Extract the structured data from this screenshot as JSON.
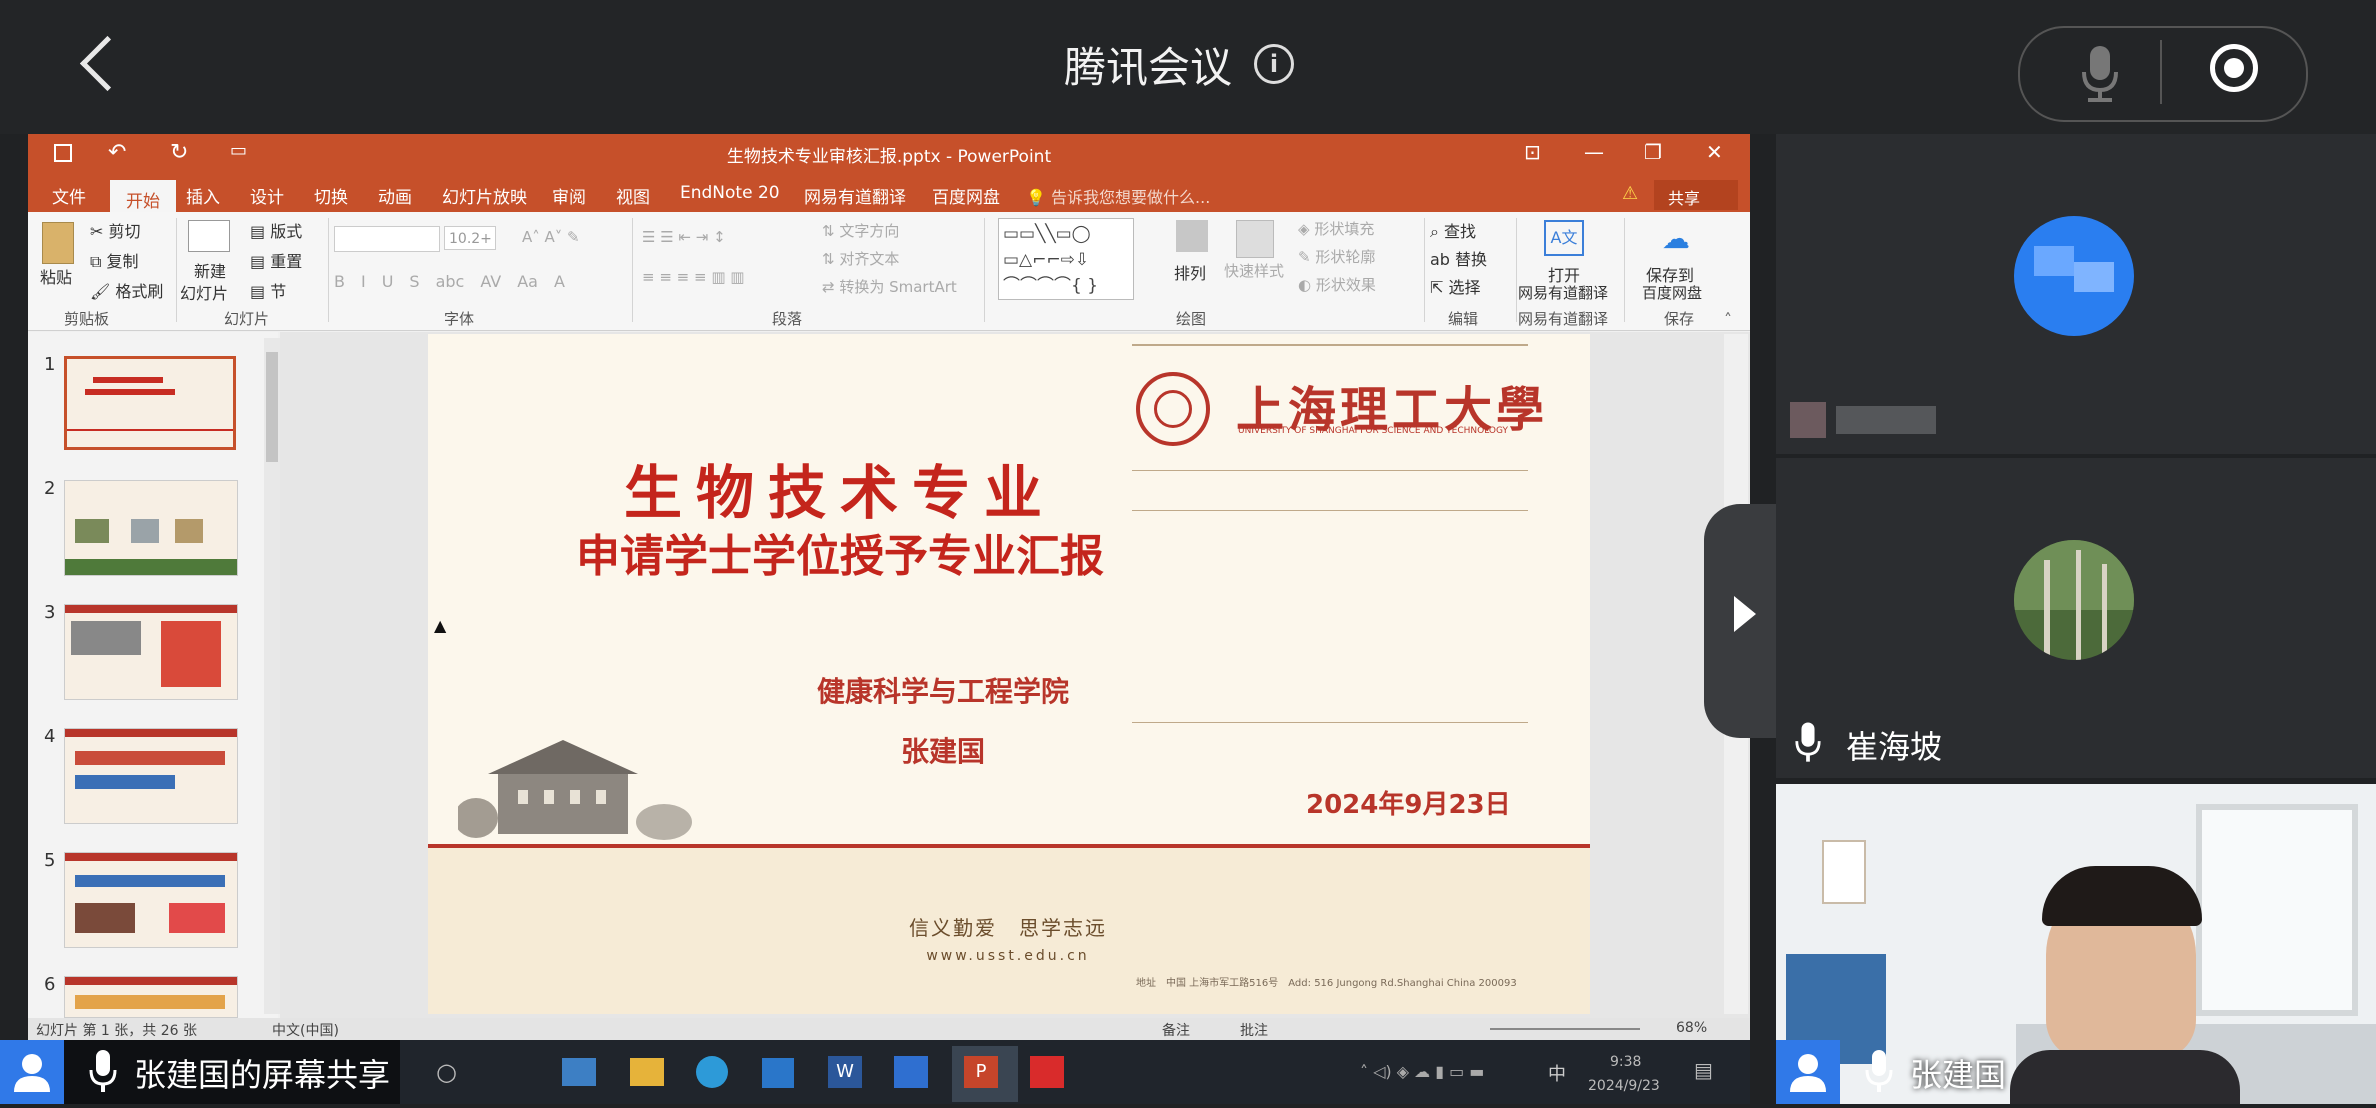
{
  "meeting": {
    "app_title": "腾讯会议",
    "share_label": "张建国的屏幕共享"
  },
  "ppt": {
    "window_title": "生物技术专业审核汇报.pptx - PowerPoint",
    "menu": [
      "文件",
      "开始",
      "插入",
      "设计",
      "切换",
      "动画",
      "幻灯片放映",
      "审阅",
      "视图",
      "EndNote 20",
      "网易有道翻译",
      "百度网盘"
    ],
    "tell_me": "告诉我您想要做什么...",
    "share": "共享",
    "ribbon": {
      "paste": "粘贴",
      "cut": "剪切",
      "copy": "复制",
      "format_painter": "格式刷",
      "clipboard_group": "剪贴板",
      "new_slide": "新建",
      "new_slide2": "幻灯片",
      "layout": "版式",
      "reset": "重置",
      "section": "节",
      "slides_group": "幻灯片",
      "font_size": "10.2+",
      "font_group": "字体",
      "text_direction": "文字方向",
      "align_text": "对齐文本",
      "smartart": "转换为 SmartArt",
      "paragraph_group": "段落",
      "arrange": "排列",
      "quick_styles": "快速样式",
      "shape_fill": "形状填充",
      "shape_outline": "形状轮廓",
      "shape_effects": "形状效果",
      "drawing_group": "绘图",
      "find": "查找",
      "replace": "替换",
      "select": "选择",
      "editing_group": "编辑",
      "open_youdao": "打开",
      "open_youdao2": "网易有道翻译",
      "youdao_group": "网易有道翻译",
      "save_baidu": "保存到",
      "save_baidu2": "百度网盘",
      "save_group": "保存"
    },
    "slide_numbers": [
      "1",
      "2",
      "3",
      "4",
      "5",
      "6"
    ],
    "slide": {
      "university_cn": "上海理工大學",
      "university_en": "UNIVERSITY OF SHANGHAI FOR SCIENCE AND TECHNOLOGY",
      "title_line1": "生物技术专业",
      "title_line2": "申请学士学位授予专业汇报",
      "school": "健康科学与工程学院",
      "presenter": "张建国",
      "date": "2024年9月23日",
      "motto": "信义勤爱　思学志远",
      "website": "www.usst.edu.cn",
      "address_label": "地址",
      "address_cn": "中国 上海市军工路516号",
      "address_en_label": "Add:",
      "address_en": "516 Jungong Rd.Shanghai China 200093"
    },
    "status": {
      "slide_info": "幻灯片 第 1 张，共 26 张",
      "language": "中文(中国)",
      "notes": "备注",
      "comments": "批注",
      "zoom": "68%"
    }
  },
  "taskbar": {
    "time": "9:38",
    "date": "2024/9/23",
    "ime": "中"
  },
  "participants": [
    {
      "name": "",
      "avatar": "pixelated-avatar"
    },
    {
      "name": "崔海坡",
      "avatar": "trees-avatar"
    },
    {
      "name": "张建国",
      "avatar": "camera-video"
    }
  ]
}
